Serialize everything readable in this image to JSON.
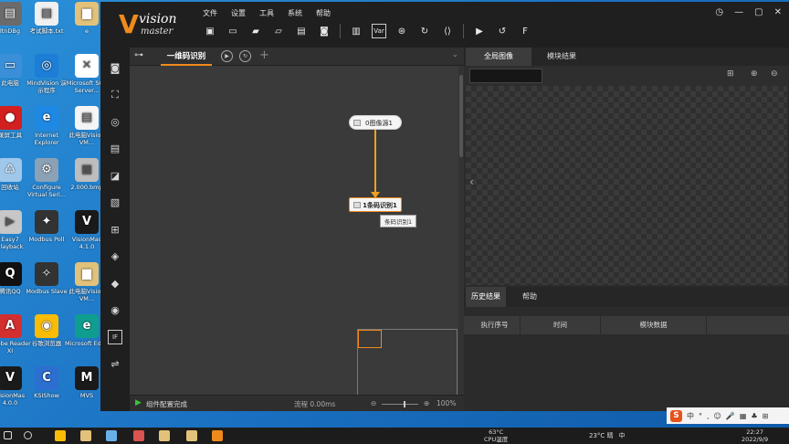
{
  "desktop": {
    "icons": [
      {
        "label": "ltnDBg",
        "color": "#6b6b6b",
        "glyph": "▤"
      },
      {
        "label": "考试脚本.txt",
        "color": "#f0f0f0",
        "glyph": "▤"
      },
      {
        "label": "e",
        "color": "#e2c27a",
        "glyph": "▆"
      },
      {
        "label": "此电脑",
        "color": "#3b8fd9",
        "glyph": "▭"
      },
      {
        "label": "MindVision 演示程序",
        "color": "#1c7ed6",
        "glyph": "◎"
      },
      {
        "label": "Microsoft SQL Server...",
        "color": "#ffffff",
        "glyph": "✕"
      },
      {
        "label": "录屏工具",
        "color": "#d21f1f",
        "glyph": "●"
      },
      {
        "label": "Internet Explorer",
        "color": "#1e88e5",
        "glyph": "e"
      },
      {
        "label": "此电脑Vision VM...",
        "color": "#f5f5f5",
        "glyph": "▤"
      },
      {
        "label": "回收站",
        "color": "#9fc7ea",
        "glyph": "♺"
      },
      {
        "label": "Configure Virtual Seri...",
        "color": "#8aa1b6",
        "glyph": "⚙"
      },
      {
        "label": "2.000.bmp",
        "color": "#bdbdbd",
        "glyph": "▦"
      },
      {
        "label": "Easy7 Playback",
        "color": "#c7c7c7",
        "glyph": "▶"
      },
      {
        "label": "Modbus Poll",
        "color": "#333333",
        "glyph": "✦"
      },
      {
        "label": "VisionMas 4.1.0",
        "color": "#1a1a1a",
        "glyph": "V"
      },
      {
        "label": "腾讯QQ",
        "color": "#111111",
        "glyph": "Q"
      },
      {
        "label": "Modbus Slave",
        "color": "#333333",
        "glyph": "✧"
      },
      {
        "label": "此电脑Vision VM...",
        "color": "#e2c27a",
        "glyph": "▆"
      },
      {
        "label": "Adobe Reader XI",
        "color": "#d32f2f",
        "glyph": "A"
      },
      {
        "label": "谷歌浏览器",
        "color": "#fbbc05",
        "glyph": "◉"
      },
      {
        "label": "Microsoft Edge",
        "color": "#0f9d8f",
        "glyph": "e"
      },
      {
        "label": "VisionMas 4.0.0",
        "color": "#1a1a1a",
        "glyph": "V"
      },
      {
        "label": "KSIShow",
        "color": "#2c6fd1",
        "glyph": "C"
      },
      {
        "label": "MVS",
        "color": "#1a1a1a",
        "glyph": "M"
      }
    ]
  },
  "app": {
    "logo": {
      "mark": "V",
      "line1": "vision",
      "line2": "master"
    },
    "menu": [
      "文件",
      "设置",
      "工具",
      "系统",
      "帮助"
    ],
    "toolbar_icons": [
      "save-icon",
      "open-folder-icon",
      "import-icon",
      "export-icon",
      "camera-save-icon",
      "snapshot-icon",
      "controller-icon",
      "variable-icon",
      "communication-icon",
      "global-trigger-icon",
      "script-icon",
      "run-once-icon",
      "run-loop-icon",
      "fullscreen-icon"
    ],
    "toolbar_glyphs": [
      "▣",
      "▭",
      "▰",
      "▱",
      "▤",
      "◙",
      "▥",
      "Var",
      "⊛",
      "↻",
      "⟨⟩",
      "▶",
      "↺",
      "F"
    ],
    "window_controls": [
      "◷",
      "—",
      "▢",
      "✕"
    ],
    "tool_column_glyphs": [
      "◙",
      "⛶",
      "◎",
      "▤",
      "◪",
      "▧",
      "⊞",
      "◈",
      "◆",
      "◉",
      "IF",
      "⇌"
    ],
    "process": {
      "tab_label": "一维码识别",
      "nodes": {
        "source": "0图像源1",
        "barcode": "1条码识别1"
      },
      "tooltip": "条码识别1",
      "status": {
        "message": "组件配置完成",
        "flow_label": "流程",
        "flow_time": "0.00ms",
        "zoom_minus": "⊖",
        "zoom_plus": "⊕",
        "zoom_pct": "100%"
      }
    },
    "image_panel": {
      "tabs": [
        "全局图像",
        "模块结果"
      ]
    },
    "history_panel": {
      "tabs": [
        "历史结果",
        "帮助"
      ],
      "columns": [
        "执行序号",
        "时间",
        "模块数据"
      ]
    }
  },
  "ime": {
    "logo": "S",
    "items": [
      "中",
      "°",
      ",",
      "☺",
      "🎤",
      "▦",
      "♣",
      "⊞"
    ]
  },
  "taskbar": {
    "weather_temp": "63°C",
    "weather_desc": "CPU温度",
    "tray_temp": "23°C 晴",
    "tray_lang": "中",
    "clock_time": "22:27",
    "clock_date": "2022/9/9"
  },
  "colors": {
    "accent": "#f08a1c",
    "status_ok": "#3cc13c"
  }
}
